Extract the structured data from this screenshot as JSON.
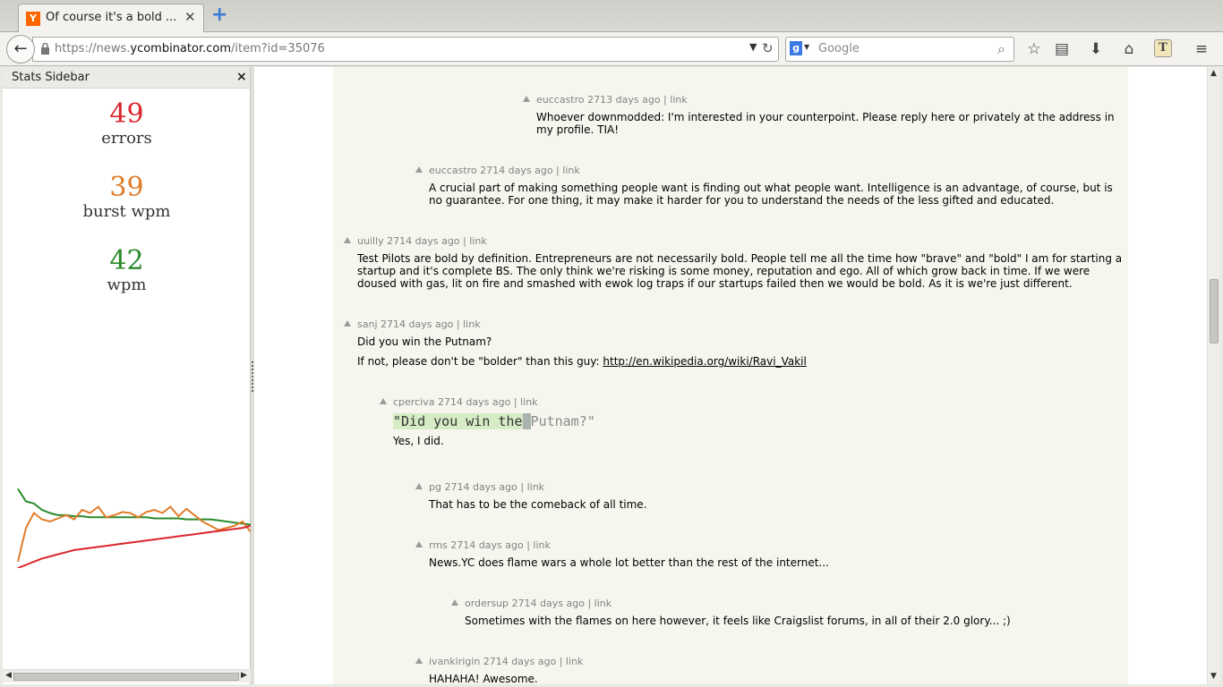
{
  "browser": {
    "tab_title": "Of course it's a bold ...",
    "tab_favicon_letter": "Y",
    "url_prefix": "https://news.",
    "url_host": "ycombinator.com",
    "url_path": "/item?id=35076",
    "search_placeholder": "Google",
    "search_engine_letter": "g"
  },
  "sidebar": {
    "title": "Stats Sidebar",
    "close": "×",
    "stats": [
      {
        "value": "49",
        "label": "errors",
        "color": "#d9262e"
      },
      {
        "value": "39",
        "label": "burst wpm",
        "color": "#e07b28"
      },
      {
        "value": "42",
        "label": "wpm",
        "color": "#2b8a2b"
      }
    ]
  },
  "chart_data": {
    "type": "line",
    "series": [
      {
        "color": "#2b8a2b",
        "values": [
          75,
          63,
          61,
          55,
          52,
          50,
          50,
          49,
          49,
          48,
          48,
          48,
          48,
          48,
          48,
          48,
          48,
          47,
          47,
          47,
          47,
          46,
          46,
          46,
          46,
          45,
          44,
          43,
          42,
          41
        ]
      },
      {
        "color": "#e07b28",
        "values": [
          6,
          38,
          52,
          46,
          44,
          47,
          50,
          46,
          55,
          52,
          58,
          48,
          50,
          53,
          52,
          48,
          53,
          55,
          52,
          58,
          49,
          56,
          50,
          44,
          40,
          36,
          38,
          40,
          44,
          34
        ]
      },
      {
        "color": "#d9262e",
        "values": [
          0,
          3,
          6,
          9,
          11,
          13,
          15,
          17,
          18,
          19,
          20,
          21,
          22,
          23,
          24,
          25,
          26,
          27,
          28,
          29,
          30,
          31,
          32,
          33,
          34,
          35,
          36,
          37,
          38,
          40
        ]
      }
    ],
    "ylim": [
      0,
      110
    ]
  },
  "comments": [
    {
      "user": "euccastro",
      "age": "2713 days ago",
      "sep": "|",
      "link": "link",
      "paragraphs": [
        "Whoever downmodded: I'm interested in your counterpoint. Please reply here or privately at the address in my profile. TIA!"
      ]
    },
    {
      "user": "euccastro",
      "age": "2714 days ago",
      "sep": "|",
      "link": "link",
      "paragraphs": [
        "A crucial part of making something people want is finding out what people want. Intelligence is an advantage, of course, but is no guarantee. For one thing, it may make it harder for you to understand the needs of the less gifted and educated."
      ]
    },
    {
      "user": "uuilly",
      "age": "2714 days ago",
      "sep": "|",
      "link": "link",
      "paragraphs": [
        "Test Pilots are bold by definition. Entrepreneurs are not necessarily bold. People tell me all the time how \"brave\" and \"bold\" I am for starting a startup and it's complete BS. The only think we're risking is some money, reputation and ego. All of which grow back in time. If we were doused with gas, lit on fire and smashed with ewok log traps if our startups failed then we would be bold. As it is we're just different."
      ]
    },
    {
      "user": "sanj",
      "age": "2714 days ago",
      "sep": "|",
      "link": "link",
      "paragraphs": [
        "Did you win the Putnam?"
      ],
      "prefix": "If not, please don't be \"bolder\" than this guy: ",
      "href_text": "http://en.wikipedia.org/wiki/Ravi_Vakil"
    },
    {
      "user": "cperciva",
      "age": "2714 days ago",
      "sep": "|",
      "link": "link",
      "typed_done": "\"Did you win the",
      "typed_cursor": " ",
      "typed_rest": "Putnam?\"",
      "paragraphs": [
        "Yes, I did."
      ]
    },
    {
      "user": "pg",
      "age": "2714 days ago",
      "sep": "|",
      "link": "link",
      "paragraphs": [
        "That has to be the comeback of all time."
      ]
    },
    {
      "user": "rms",
      "age": "2714 days ago",
      "sep": "|",
      "link": "link",
      "paragraphs": [
        "News.YC does flame wars a whole lot better than the rest of the internet..."
      ]
    },
    {
      "user": "ordersup",
      "age": "2714 days ago",
      "sep": "|",
      "link": "link",
      "paragraphs": [
        "Sometimes with the flames on here however, it feels like Craigslist forums, in all of their 2.0 glory... ;)"
      ]
    },
    {
      "user": "ivankirigin",
      "age": "2714 days ago",
      "sep": "|",
      "link": "link",
      "paragraphs": [
        "HAHAHA! Awesome."
      ]
    }
  ]
}
